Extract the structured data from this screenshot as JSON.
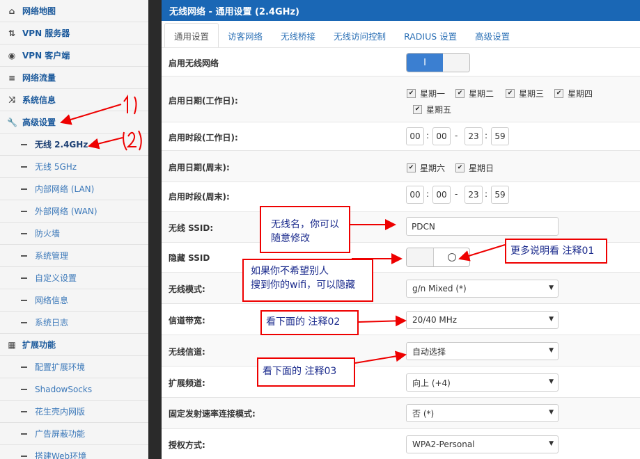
{
  "sidebar": {
    "items": [
      {
        "label": "网络地图",
        "icon": "home-icon",
        "kind": "top"
      },
      {
        "label": "VPN 服务器",
        "icon": "retweet-icon",
        "kind": "top"
      },
      {
        "label": "VPN 客户端",
        "icon": "globe-icon",
        "kind": "top"
      },
      {
        "label": "网络流量",
        "icon": "hdd-icon",
        "kind": "top"
      },
      {
        "label": "系统信息",
        "icon": "shuffle-icon",
        "kind": "top"
      },
      {
        "label": "高级设置",
        "icon": "wrench-icon",
        "kind": "top"
      },
      {
        "label": "无线 2.4GHz",
        "kind": "sub-active"
      },
      {
        "label": "无线 5GHz",
        "kind": "sub"
      },
      {
        "label": "内部网络 (LAN)",
        "kind": "sub"
      },
      {
        "label": "外部网络 (WAN)",
        "kind": "sub"
      },
      {
        "label": "防火墙",
        "kind": "sub"
      },
      {
        "label": "系统管理",
        "kind": "sub"
      },
      {
        "label": "自定义设置",
        "kind": "sub"
      },
      {
        "label": "网络信息",
        "kind": "sub"
      },
      {
        "label": "系统日志",
        "kind": "sub"
      },
      {
        "label": "扩展功能",
        "icon": "th-icon",
        "kind": "top"
      },
      {
        "label": "配置扩展环境",
        "kind": "sub"
      },
      {
        "label": "ShadowSocks",
        "kind": "sub"
      },
      {
        "label": "花生壳内网版",
        "kind": "sub"
      },
      {
        "label": "广告屏蔽功能",
        "kind": "sub"
      },
      {
        "label": "搭建Web环境",
        "kind": "sub"
      }
    ]
  },
  "panel": {
    "title": "无线网络 - 通用设置 (2.4GHz)",
    "tabs": [
      "通用设置",
      "访客网络",
      "无线桥接",
      "无线访问控制",
      "RADIUS 设置",
      "高级设置"
    ],
    "active_tab": 0
  },
  "form": {
    "enable_wireless": {
      "label": "启用无线网络",
      "toggle_on_text": "I"
    },
    "weekday_days": {
      "label": "启用日期(工作日):",
      "days": [
        "星期一",
        "星期二",
        "星期三",
        "星期四",
        "星期五"
      ]
    },
    "weekday_time": {
      "label": "启用时段(工作日):",
      "values": [
        "00",
        "00",
        "23",
        "59"
      ]
    },
    "weekend_days": {
      "label": "启用日期(周末):",
      "days": [
        "星期六",
        "星期日"
      ]
    },
    "weekend_time": {
      "label": "启用时段(周末):",
      "values": [
        "00",
        "00",
        "23",
        "59"
      ]
    },
    "ssid": {
      "label": "无线 SSID:",
      "value": "PDCN"
    },
    "hide_ssid": {
      "label": "隐藏 SSID"
    },
    "mode": {
      "label": "无线模式:",
      "value": "g/n Mixed (*)"
    },
    "bandwidth": {
      "label": "信道带宽:",
      "value": "20/40 MHz"
    },
    "channel": {
      "label": "无线信道:",
      "value": "自动选择"
    },
    "ext_channel": {
      "label": "扩展频道:",
      "value": "向上 (+4)"
    },
    "fixed_rate": {
      "label": "固定发射速率连接模式:",
      "value": "否 (*)"
    },
    "auth": {
      "label": "授权方式:",
      "value": "WPA2-Personal"
    }
  },
  "annotations": {
    "num1": "1",
    "num2": "2",
    "ssid_note": "无线名，你可以\n随意修改",
    "hide_note": "如果你不希望别人\n搜到你的wifi，可以隐藏",
    "more_note": "更多说明看 注释01",
    "bw_note": "看下面的 注释02",
    "ch_note": "看下面的 注释03"
  },
  "colors": {
    "accent": "#1a67b5",
    "annotation": "#e00000"
  }
}
